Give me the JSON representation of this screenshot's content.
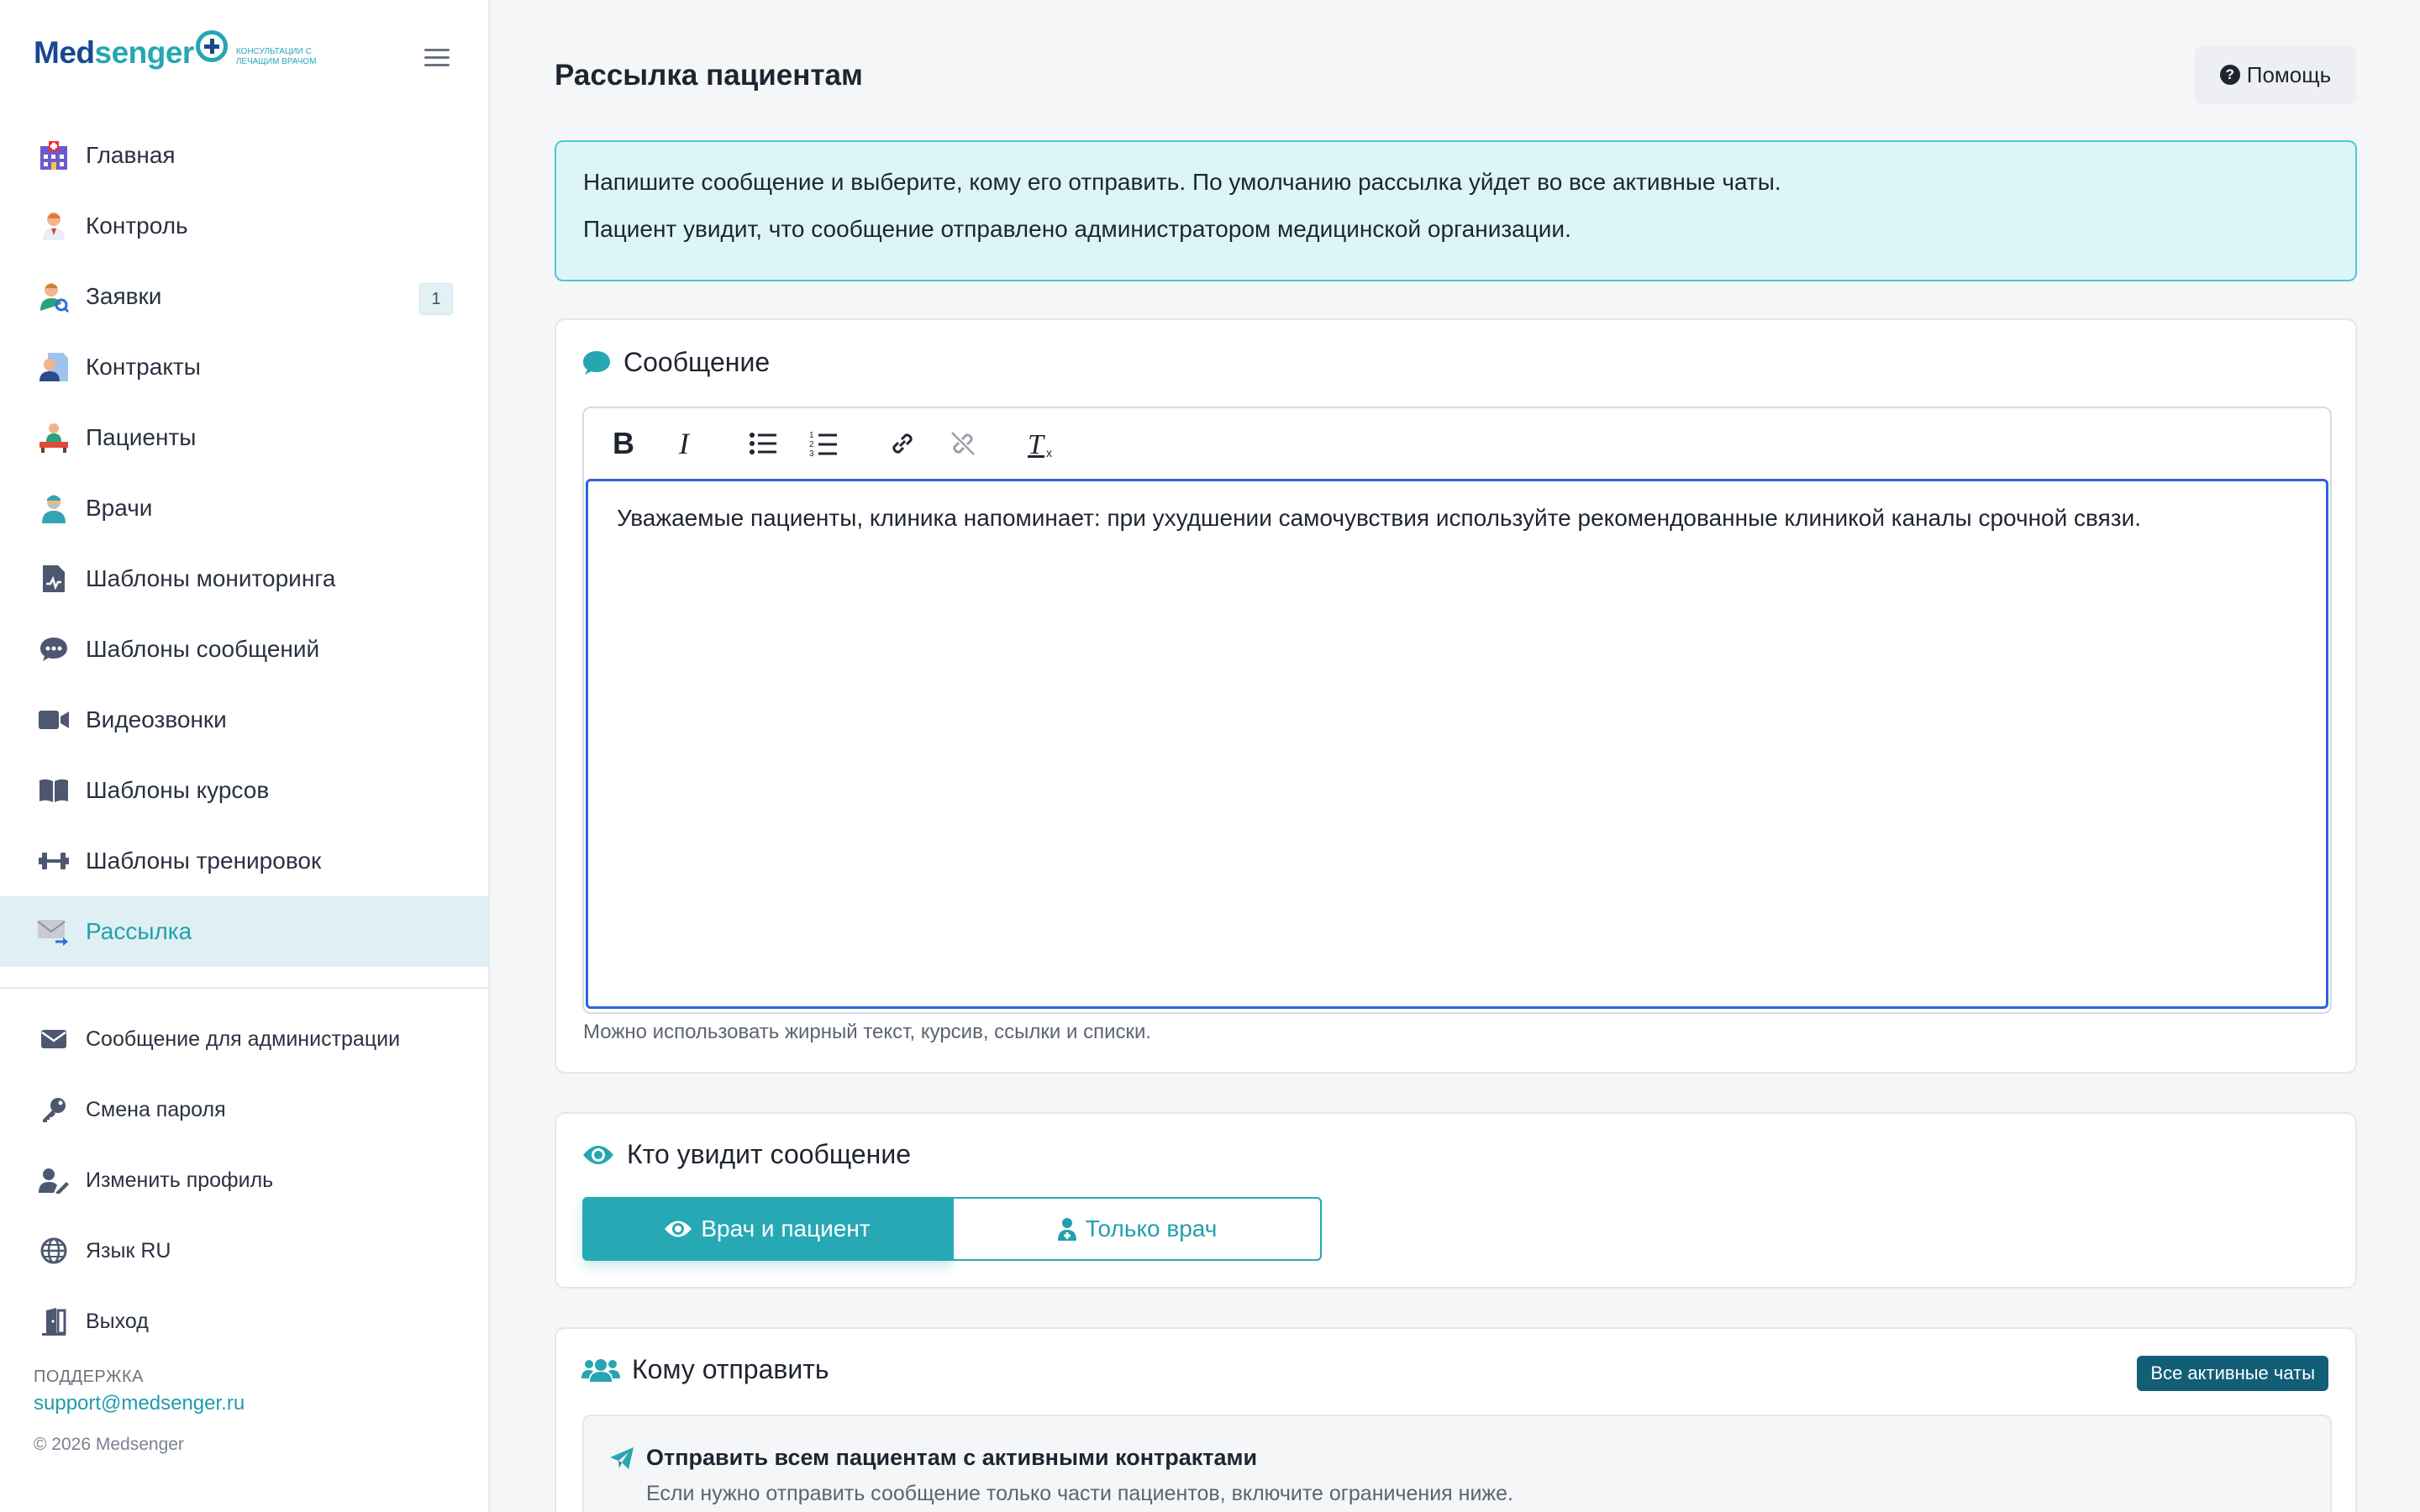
{
  "brand": {
    "name_part1": "Med",
    "name_part2": "senger",
    "tagline": "КОНСУЛЬТАЦИИ С ЛЕЧАЩИМ ВРАЧОМ"
  },
  "sidebar": {
    "items": [
      {
        "label": "Главная",
        "icon": "hospital-icon"
      },
      {
        "label": "Контроль",
        "icon": "doctor-icon"
      },
      {
        "label": "Заявки",
        "icon": "user-search-icon",
        "badge": "1"
      },
      {
        "label": "Контракты",
        "icon": "contract-icon"
      },
      {
        "label": "Пациенты",
        "icon": "patient-icon"
      },
      {
        "label": "Врачи",
        "icon": "doctor-nurse-icon"
      },
      {
        "label": "Шаблоны мониторинга",
        "icon": "file-chart-icon"
      },
      {
        "label": "Шаблоны сообщений",
        "icon": "comment-dots-icon"
      },
      {
        "label": "Видеозвонки",
        "icon": "video-icon"
      },
      {
        "label": "Шаблоны курсов",
        "icon": "book-icon"
      },
      {
        "label": "Шаблоны тренировок",
        "icon": "dumbbell-icon"
      },
      {
        "label": "Рассылка",
        "icon": "mail-send-icon",
        "active": true
      }
    ],
    "bottom_items": [
      {
        "label": "Сообщение для администрации",
        "icon": "envelope-icon"
      },
      {
        "label": "Смена пароля",
        "icon": "key-icon"
      },
      {
        "label": "Изменить профиль",
        "icon": "user-edit-icon"
      },
      {
        "label": "Язык RU",
        "icon": "globe-icon"
      },
      {
        "label": "Выход",
        "icon": "door-exit-icon"
      }
    ],
    "support_label": "ПОДДЕРЖКА",
    "support_email": "support@medsenger.ru",
    "copyright": "© 2026 Medsenger"
  },
  "header": {
    "title": "Рассылка пациентам",
    "help_label": "Помощь"
  },
  "info": {
    "line1": "Напишите сообщение и выберите, кому его отправить. По умолчанию рассылка уйдет во все активные чаты.",
    "line2": "Пациент увидит, что сообщение отправлено администратором медицинской организации."
  },
  "message_card": {
    "title": "Сообщение",
    "body_text": "Уважаемые пациенты, клиника напоминает: при ухудшении самочувствия используйте рекомендованные клиникой каналы срочной связи.",
    "hint": "Можно использовать жирный текст, курсив, ссылки и списки.",
    "toolbar": [
      "bold",
      "italic",
      "bullet-list",
      "numbered-list",
      "link",
      "unlink",
      "clear-format"
    ]
  },
  "visibility_card": {
    "title": "Кто увидит сообщение",
    "option_both": "Врач и пациент",
    "option_doctor": "Только врач",
    "selected": "both"
  },
  "recipients_card": {
    "title": "Кому отправить",
    "badge": "Все активные чаты",
    "option_title": "Отправить всем пациентам с активными контрактами",
    "option_sub": "Если нужно отправить сообщение только части пациентов, включите ограничения ниже."
  },
  "colors": {
    "accent": "#27a9b5",
    "brand_dark": "#17498f",
    "focus": "#2e64d8",
    "active_bg": "#e0eff3"
  }
}
